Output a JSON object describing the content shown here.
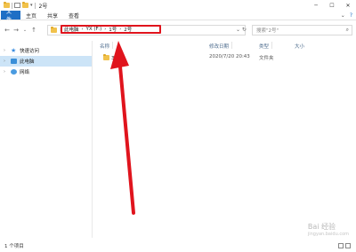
{
  "window": {
    "title": "2号",
    "minimize_icon": "minimize-icon",
    "maximize_icon": "maximize-icon",
    "close_icon": "close-icon"
  },
  "ribbon": {
    "tabs": [
      {
        "label": "文件"
      },
      {
        "label": "主页"
      },
      {
        "label": "共享"
      },
      {
        "label": "查看"
      }
    ]
  },
  "address": {
    "crumbs": [
      {
        "label": "此电脑"
      },
      {
        "label": "YX (F:)"
      },
      {
        "label": "1号"
      },
      {
        "label": "2号"
      }
    ],
    "separator": "›"
  },
  "search": {
    "placeholder": "搜索\"2号\""
  },
  "nav": {
    "items": [
      {
        "label": "快速访问",
        "icon": "star-icon"
      },
      {
        "label": "此电脑",
        "icon": "computer-icon"
      },
      {
        "label": "网络",
        "icon": "network-icon"
      }
    ]
  },
  "columns": {
    "name": "名称",
    "modified": "修改日期",
    "type": "类型",
    "size": "大小"
  },
  "files": [
    {
      "name": "3号",
      "modified": "2020/7/20 20:43",
      "type": "文件夹",
      "size": ""
    }
  ],
  "status": {
    "count": "1 个项目"
  },
  "watermark": {
    "text": "Bai 经验",
    "sub": "jingyan.baidu.com"
  },
  "colors": {
    "highlight": "#e0141d",
    "file_tab": "#1f6fc5",
    "selected_nav": "#cce4f7"
  }
}
